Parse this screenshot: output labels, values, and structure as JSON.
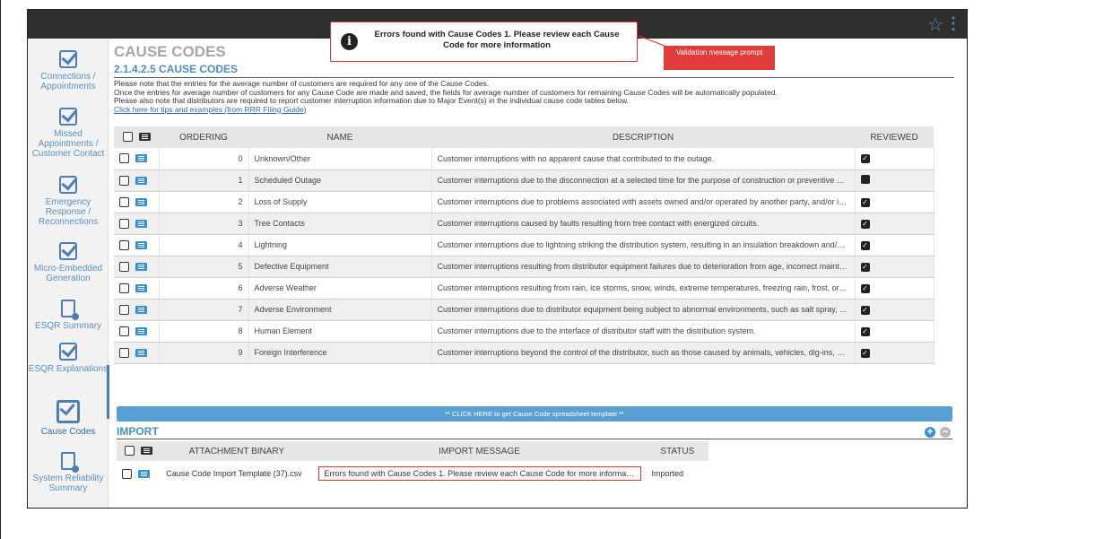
{
  "toast": {
    "message": "Errors found with Cause Codes 1. Please review each Cause Code for more information"
  },
  "callout": {
    "label": "Validation message prompt"
  },
  "sidebar": {
    "items": [
      {
        "label": "Connections / Appointments",
        "icon": "checkbox-icon"
      },
      {
        "label": "Missed Appointments / Customer Contact",
        "icon": "checkbox-icon"
      },
      {
        "label": "Emergency Response / Reconnections",
        "icon": "checkbox-icon"
      },
      {
        "label": "Micro-Embedded Generation",
        "icon": "checkbox-icon"
      },
      {
        "label": "ESQR Summary",
        "icon": "document-icon"
      },
      {
        "label": "ESQR Explanations",
        "icon": "checkbox-icon"
      },
      {
        "label": "Cause Codes",
        "icon": "checkbox-icon",
        "active": true
      },
      {
        "label": "System Reliability Summary",
        "icon": "document-icon"
      }
    ]
  },
  "page": {
    "title": "CAUSE CODES",
    "subtitle": "2.1.4.2.5 CAUSE CODES",
    "note1": "Please note that the entries for the average number of customers are required for any one of the Cause Codes.",
    "note2": "Once the entries for average number of customers for any Cause Code are made and saved, the fields for average number of customers for remaining Cause Codes will be automatically populated.",
    "note3": "Please also note that distributors are required to report customer interruption information due to Major Event(s) in the individual cause code tables below.",
    "link": "Click here for tips and examples (from RRR Filing Guide)"
  },
  "grid": {
    "headers": {
      "ordering": "ORDERING",
      "name": "NAME",
      "description": "DESCRIPTION",
      "reviewed": "REVIEWED"
    },
    "rows": [
      {
        "ordering": "0",
        "name": "Unknown/Other",
        "description": "Customer interruptions with no apparent cause that contributed to the outage.",
        "reviewed": true
      },
      {
        "ordering": "1",
        "name": "Scheduled Outage",
        "description": "Customer interruptions due to the disconnection at a selected time for the purpose of construction or preventive mai…",
        "reviewed": false
      },
      {
        "ordering": "2",
        "name": "Loss of Supply",
        "description": "Customer interruptions due to problems associated with assets owned and/or operated by another party, and/or in t…",
        "reviewed": true
      },
      {
        "ordering": "3",
        "name": "Tree Contacts",
        "description": "Customer interruptions caused by faults resulting from tree contact with energized circuits.",
        "reviewed": true
      },
      {
        "ordering": "4",
        "name": "Lightning",
        "description": "Customer interruptions due to lightning striking the distribution system, resulting in an insulation breakdown and/or fl…",
        "reviewed": true
      },
      {
        "ordering": "5",
        "name": "Defective Equipment",
        "description": "Customer interruptions resulting from distributor equipment failures due to deterioration from age, incorrect mainten…",
        "reviewed": true
      },
      {
        "ordering": "6",
        "name": "Adverse Weather",
        "description": "Customer interruptions resulting from rain, ice storms, snow, winds, extreme temperatures, freezing rain, frost, or ot…",
        "reviewed": true
      },
      {
        "ordering": "7",
        "name": "Adverse Environment",
        "description": "Customer interruptions due to distributor equipment being subject to abnormal environments, such as salt spray, ind…",
        "reviewed": true
      },
      {
        "ordering": "8",
        "name": "Human Element",
        "description": "Customer interruptions due to the interface of distributor staff with the distribution system.",
        "reviewed": true
      },
      {
        "ordering": "9",
        "name": "Foreign Interference",
        "description": "Customer interruptions beyond the control of the distributor, such as those caused by animals, vehicles, dig-ins, van…",
        "reviewed": true
      }
    ]
  },
  "template_button": "** CLICK HERE to get Cause Code spreadsheet template **",
  "import": {
    "title": "IMPORT",
    "headers": {
      "attachment": "ATTACHMENT BINARY",
      "message": "IMPORT MESSAGE",
      "status": "STATUS"
    },
    "row": {
      "attachment": "Cause Code Import Template (37).csv",
      "message": "Errors found with Cause Codes 1. Please review each Cause Code for more informati…",
      "status": "Imported"
    }
  },
  "colors": {
    "accent": "#4b8ec7",
    "error": "#d33333",
    "topbar": "#2f2f2f"
  }
}
